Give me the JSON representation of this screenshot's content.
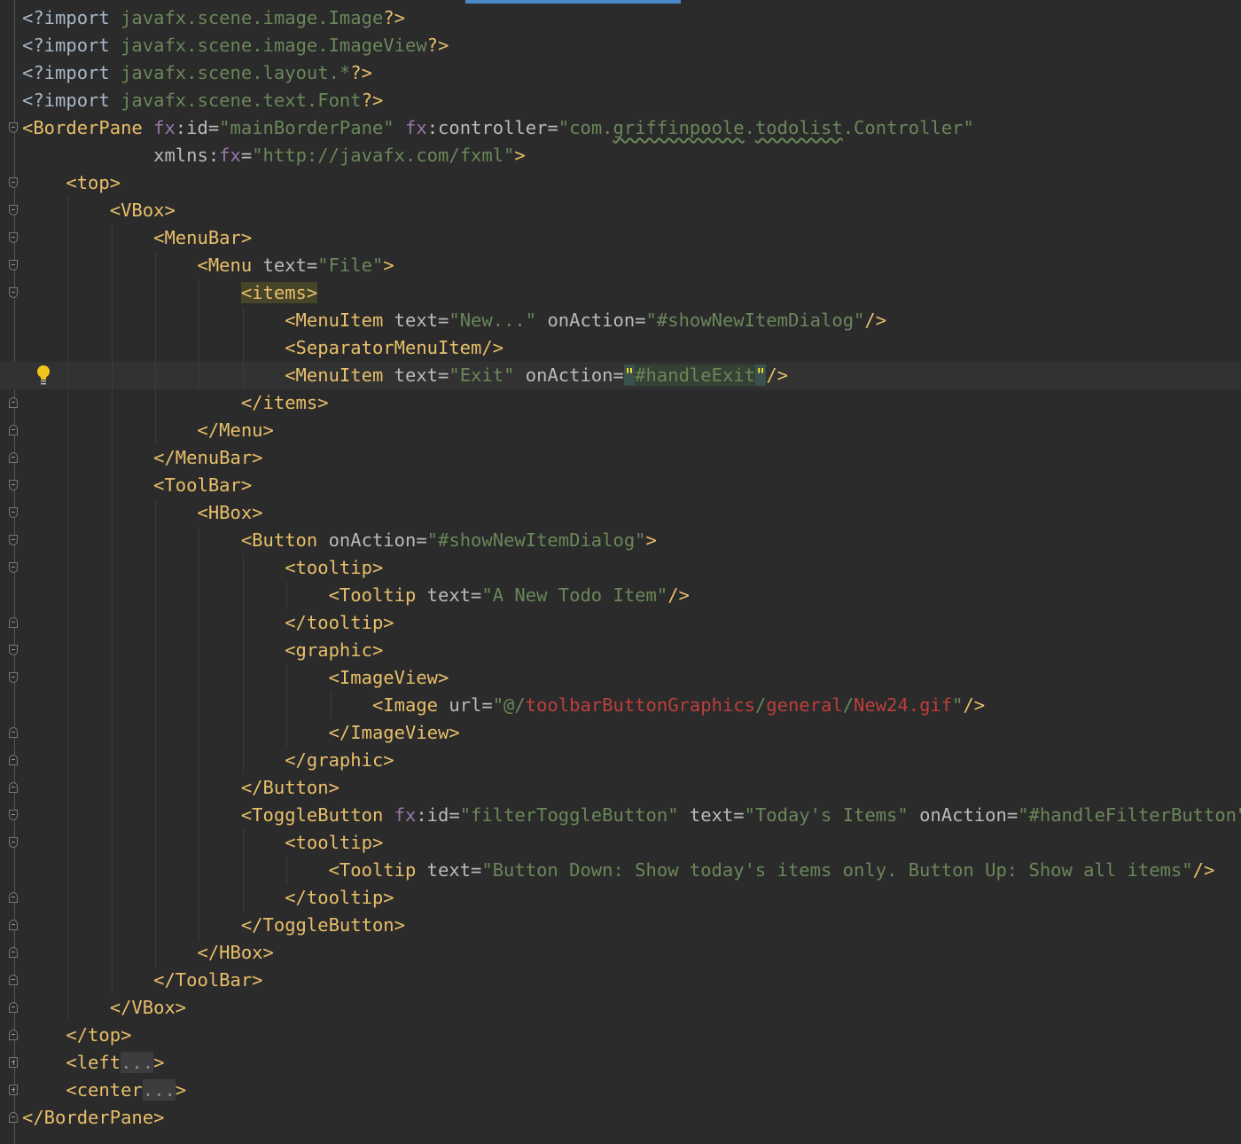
{
  "editor": {
    "language": "FXML",
    "colors": {
      "background": "#2b2b2b",
      "tag": "#e8bf6a",
      "attribute": "#bababa",
      "namespace": "#9876aa",
      "value": "#6a8759",
      "error": "#bc3f3c"
    },
    "lines": [
      {
        "fold": "none",
        "tokens": [
          {
            "t": "<?import ",
            "c": "pi"
          },
          {
            "t": "javafx.scene.image.Image",
            "c": "vl"
          },
          {
            "t": "?>",
            "c": "tg"
          }
        ]
      },
      {
        "fold": "none",
        "tokens": [
          {
            "t": "<?import ",
            "c": "pi"
          },
          {
            "t": "javafx.scene.image.ImageView",
            "c": "vl"
          },
          {
            "t": "?>",
            "c": "tg"
          }
        ]
      },
      {
        "fold": "none",
        "tokens": [
          {
            "t": "<?import ",
            "c": "pi"
          },
          {
            "t": "javafx.scene.layout.*",
            "c": "vl"
          },
          {
            "t": "?>",
            "c": "tg"
          }
        ]
      },
      {
        "fold": "none",
        "tokens": [
          {
            "t": "<?import ",
            "c": "pi"
          },
          {
            "t": "javafx.scene.text.Font",
            "c": "vl"
          },
          {
            "t": "?>",
            "c": "tg"
          }
        ]
      },
      {
        "fold": "open",
        "tokens": [
          {
            "t": "<BorderPane ",
            "c": "tg"
          },
          {
            "t": "fx",
            "c": "ns"
          },
          {
            "t": ":id=",
            "c": "at"
          },
          {
            "t": "\"mainBorderPane\" ",
            "c": "vl"
          },
          {
            "t": "fx",
            "c": "ns"
          },
          {
            "t": ":controller=",
            "c": "at"
          },
          {
            "t": "\"com.",
            "c": "vl"
          },
          {
            "t": "griffinpoole",
            "c": "vl uw"
          },
          {
            "t": ".",
            "c": "vl"
          },
          {
            "t": "todolist",
            "c": "vl uw"
          },
          {
            "t": ".Controller\"",
            "c": "vl"
          }
        ]
      },
      {
        "fold": "none",
        "tokens": [
          {
            "t": "            xmlns:",
            "c": "at"
          },
          {
            "t": "fx",
            "c": "ns"
          },
          {
            "t": "=",
            "c": "at"
          },
          {
            "t": "\"http://javafx.com/fxml\"",
            "c": "vl"
          },
          {
            "t": ">",
            "c": "tg"
          }
        ]
      },
      {
        "fold": "open",
        "tokens": [
          {
            "t": "    <top>",
            "c": "tg"
          }
        ]
      },
      {
        "fold": "open",
        "tokens": [
          {
            "t": "        <VBox>",
            "c": "tg"
          }
        ]
      },
      {
        "fold": "open",
        "tokens": [
          {
            "t": "            <MenuBar>",
            "c": "tg"
          }
        ]
      },
      {
        "fold": "open",
        "tokens": [
          {
            "t": "                <Menu ",
            "c": "tg"
          },
          {
            "t": "text=",
            "c": "at"
          },
          {
            "t": "\"File\"",
            "c": "vl"
          },
          {
            "t": ">",
            "c": "tg"
          }
        ]
      },
      {
        "fold": "open",
        "tokens": [
          {
            "t": "                    ",
            "c": "at"
          },
          {
            "t": "<items>",
            "c": "tg hl-tag"
          }
        ]
      },
      {
        "fold": "none",
        "tokens": [
          {
            "t": "                        <MenuItem ",
            "c": "tg"
          },
          {
            "t": "text=",
            "c": "at"
          },
          {
            "t": "\"New...\" ",
            "c": "vl"
          },
          {
            "t": "onAction=",
            "c": "at"
          },
          {
            "t": "\"#showNewItemDialog\"",
            "c": "vl"
          },
          {
            "t": "/>",
            "c": "tg"
          }
        ]
      },
      {
        "fold": "none",
        "tokens": [
          {
            "t": "                        <SeparatorMenuItem/>",
            "c": "tg"
          }
        ]
      },
      {
        "fold": "none",
        "current": true,
        "tokens": [
          {
            "t": "                        <MenuItem ",
            "c": "tg"
          },
          {
            "t": "text=",
            "c": "at"
          },
          {
            "t": "\"Exit\" ",
            "c": "vl"
          },
          {
            "t": "onAction=",
            "c": "at"
          },
          {
            "t": "\"",
            "c": "hl-q"
          },
          {
            "t": "#handleExit",
            "c": "vl hl-val"
          },
          {
            "t": "\"",
            "c": "hl-q"
          },
          {
            "t": "/>",
            "c": "tg"
          }
        ]
      },
      {
        "fold": "close",
        "tokens": [
          {
            "t": "                    </items>",
            "c": "tg"
          }
        ]
      },
      {
        "fold": "close",
        "tokens": [
          {
            "t": "                </Menu>",
            "c": "tg"
          }
        ]
      },
      {
        "fold": "close",
        "tokens": [
          {
            "t": "            </MenuBar>",
            "c": "tg"
          }
        ]
      },
      {
        "fold": "open",
        "tokens": [
          {
            "t": "            <ToolBar>",
            "c": "tg"
          }
        ]
      },
      {
        "fold": "open",
        "tokens": [
          {
            "t": "                <HBox>",
            "c": "tg"
          }
        ]
      },
      {
        "fold": "open",
        "tokens": [
          {
            "t": "                    <Button ",
            "c": "tg"
          },
          {
            "t": "onAction=",
            "c": "at"
          },
          {
            "t": "\"#showNewItemDialog\"",
            "c": "vl"
          },
          {
            "t": ">",
            "c": "tg"
          }
        ]
      },
      {
        "fold": "open",
        "tokens": [
          {
            "t": "                        <tooltip>",
            "c": "tg"
          }
        ]
      },
      {
        "fold": "none",
        "tokens": [
          {
            "t": "                            <Tooltip ",
            "c": "tg"
          },
          {
            "t": "text=",
            "c": "at"
          },
          {
            "t": "\"A New Todo Item\"",
            "c": "vl"
          },
          {
            "t": "/>",
            "c": "tg"
          }
        ]
      },
      {
        "fold": "close",
        "tokens": [
          {
            "t": "                        </tooltip>",
            "c": "tg"
          }
        ]
      },
      {
        "fold": "open",
        "tokens": [
          {
            "t": "                        <graphic>",
            "c": "tg"
          }
        ]
      },
      {
        "fold": "open",
        "tokens": [
          {
            "t": "                            <ImageView>",
            "c": "tg"
          }
        ]
      },
      {
        "fold": "none",
        "tokens": [
          {
            "t": "                                <Image ",
            "c": "tg"
          },
          {
            "t": "url=",
            "c": "at"
          },
          {
            "t": "\"@/",
            "c": "vl"
          },
          {
            "t": "toolbarButtonGraphics",
            "c": "err"
          },
          {
            "t": "/",
            "c": "vl"
          },
          {
            "t": "general",
            "c": "err"
          },
          {
            "t": "/",
            "c": "vl"
          },
          {
            "t": "New24.gif",
            "c": "err"
          },
          {
            "t": "\"",
            "c": "vl"
          },
          {
            "t": "/>",
            "c": "tg"
          }
        ]
      },
      {
        "fold": "close",
        "tokens": [
          {
            "t": "                            </ImageView>",
            "c": "tg"
          }
        ]
      },
      {
        "fold": "close",
        "tokens": [
          {
            "t": "                        </graphic>",
            "c": "tg"
          }
        ]
      },
      {
        "fold": "close",
        "tokens": [
          {
            "t": "                    </Button>",
            "c": "tg"
          }
        ]
      },
      {
        "fold": "open",
        "tokens": [
          {
            "t": "                    <ToggleButton ",
            "c": "tg"
          },
          {
            "t": "fx",
            "c": "ns"
          },
          {
            "t": ":id=",
            "c": "at"
          },
          {
            "t": "\"filterToggleButton\" ",
            "c": "vl"
          },
          {
            "t": "text=",
            "c": "at"
          },
          {
            "t": "\"Today's Items\" ",
            "c": "vl"
          },
          {
            "t": "onAction=",
            "c": "at"
          },
          {
            "t": "\"#handleFilterButton\"",
            "c": "vl"
          },
          {
            "t": ">",
            "c": "tg"
          }
        ]
      },
      {
        "fold": "open",
        "tokens": [
          {
            "t": "                        <tooltip>",
            "c": "tg"
          }
        ]
      },
      {
        "fold": "none",
        "tokens": [
          {
            "t": "                            <Tooltip ",
            "c": "tg"
          },
          {
            "t": "text=",
            "c": "at"
          },
          {
            "t": "\"Button Down: Show today's items only. Button Up: Show all items\"",
            "c": "vl"
          },
          {
            "t": "/>",
            "c": "tg"
          }
        ]
      },
      {
        "fold": "close",
        "tokens": [
          {
            "t": "                        </tooltip>",
            "c": "tg"
          }
        ]
      },
      {
        "fold": "close",
        "tokens": [
          {
            "t": "                    </ToggleButton>",
            "c": "tg"
          }
        ]
      },
      {
        "fold": "close",
        "tokens": [
          {
            "t": "                </HBox>",
            "c": "tg"
          }
        ]
      },
      {
        "fold": "close",
        "tokens": [
          {
            "t": "            </ToolBar>",
            "c": "tg"
          }
        ]
      },
      {
        "fold": "close",
        "tokens": [
          {
            "t": "        </VBox>",
            "c": "tg"
          }
        ]
      },
      {
        "fold": "close",
        "tokens": [
          {
            "t": "    </top>",
            "c": "tg"
          }
        ]
      },
      {
        "fold": "plus",
        "tokens": [
          {
            "t": "    <left",
            "c": "tg"
          },
          {
            "t": "...",
            "c": "fold-dots"
          },
          {
            "t": ">",
            "c": "tg"
          }
        ]
      },
      {
        "fold": "plus",
        "tokens": [
          {
            "t": "    <center",
            "c": "tg"
          },
          {
            "t": "...",
            "c": "fold-dots"
          },
          {
            "t": ">",
            "c": "tg"
          }
        ]
      },
      {
        "fold": "close",
        "tokens": [
          {
            "t": "</BorderPane>",
            "c": "tg"
          }
        ]
      }
    ]
  }
}
